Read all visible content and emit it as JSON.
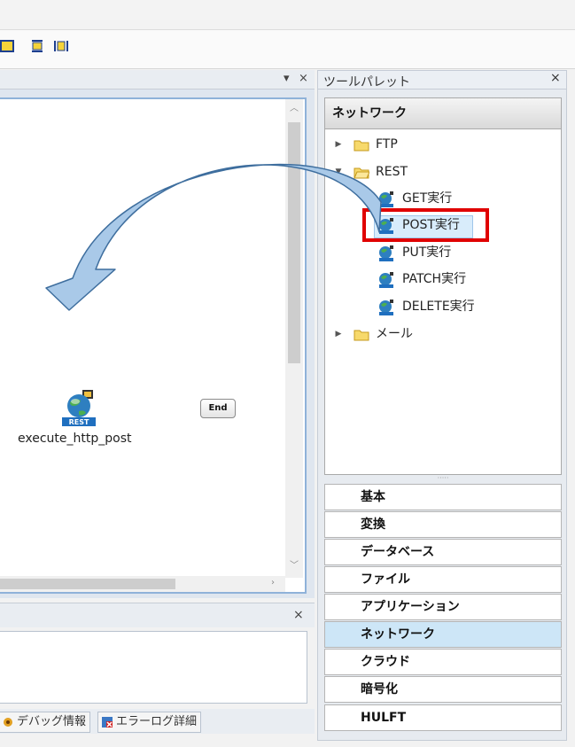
{
  "designer": {
    "node_label": "execute_http_post",
    "end_label": "End",
    "controls": {
      "pin": "▾",
      "close": "×"
    }
  },
  "log_panel": {
    "close": "×",
    "tabs": [
      {
        "label": "デバッグ情報",
        "icon": "bug-icon"
      },
      {
        "label": "エラーログ詳細",
        "icon": "error-log-icon"
      }
    ]
  },
  "palette": {
    "title": "ツールパレット",
    "close": "×",
    "section": "ネットワーク",
    "tree": {
      "folders": [
        "FTP",
        "REST",
        "メール"
      ],
      "rest_items": [
        "GET実行",
        "POST実行",
        "PUT実行",
        "PATCH実行",
        "DELETE実行"
      ],
      "selected": "POST実行"
    },
    "categories": [
      "基本",
      "変換",
      "データベース",
      "ファイル",
      "アプリケーション",
      "ネットワーク",
      "クラウド",
      "暗号化",
      "HULFT"
    ],
    "active_category": "ネットワーク"
  },
  "colors": {
    "accent_blue": "#8fb2d9",
    "highlight_red": "#e00000",
    "selected_bg": "#d8ecfb",
    "active_category_bg": "#cde6f7",
    "arrow_fill": "#a9c9e8"
  }
}
